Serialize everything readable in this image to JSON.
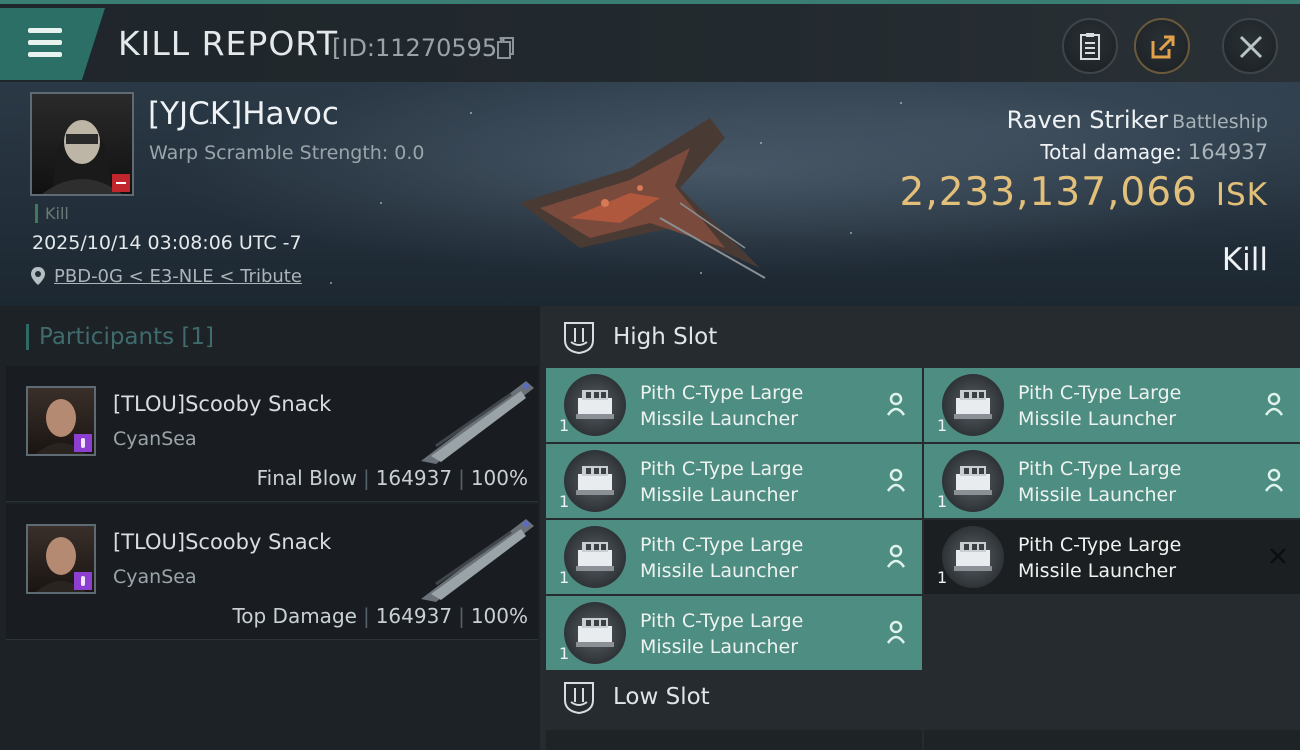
{
  "header": {
    "title": "KILL REPORT",
    "report_id": "[ID:11270595]"
  },
  "victim": {
    "name": "[YJCK]Havoc",
    "warp_scramble": "Warp Scramble Strength: 0.0",
    "tag": "Kill",
    "datetime": "2025/10/14 03:08:06 UTC -7",
    "location": "PBD-0G < E3-NLE < Tribute",
    "ship_name": "Raven Striker",
    "ship_class": "Battleship",
    "total_damage_label": "Total damage:",
    "total_damage": "164937",
    "isk_value": "2,233,137,066",
    "isk_unit": "ISK",
    "status": "Kill"
  },
  "participants": {
    "label": "Participants",
    "count": "[1]",
    "items": [
      {
        "name": "[TLOU]Scooby Snack",
        "corp": "CyanSea",
        "role": "Final Blow",
        "damage": "164937",
        "percent": "100%"
      },
      {
        "name": "[TLOU]Scooby Snack",
        "corp": "CyanSea",
        "role": "Top Damage",
        "damage": "164937",
        "percent": "100%"
      }
    ]
  },
  "slots": {
    "high_label": "High Slot",
    "low_label": "Low Slot",
    "high_modules": [
      {
        "name_line1": "Pith C-Type Large",
        "name_line2": "Missile Launcher",
        "count": "1",
        "state": "active"
      },
      {
        "name_line1": "Pith C-Type Large",
        "name_line2": "Missile Launcher",
        "count": "1",
        "state": "active"
      },
      {
        "name_line1": "Pith C-Type Large",
        "name_line2": "Missile Launcher",
        "count": "1",
        "state": "active"
      },
      {
        "name_line1": "Pith C-Type Large",
        "name_line2": "Missile Launcher",
        "count": "1",
        "state": "active"
      },
      {
        "name_line1": "Pith C-Type Large",
        "name_line2": "Missile Launcher",
        "count": "1",
        "state": "active"
      },
      {
        "name_line1": "Pith C-Type Large",
        "name_line2": "Missile Launcher",
        "count": "1",
        "state": "destroyed"
      },
      {
        "name_line1": "Pith C-Type Large",
        "name_line2": "Missile Launcher",
        "count": "1",
        "state": "active"
      }
    ]
  },
  "colors": {
    "accent_teal": "#4e8d81",
    "isk_gold": "#e2c07a",
    "minus_red": "#c0262b",
    "badge_purple": "#8c3fd1"
  },
  "icons": [
    "menu-icon",
    "copy-icon",
    "clipboard-icon",
    "share-icon",
    "close-icon",
    "location-pin-icon",
    "high-slot-icon",
    "low-slot-icon",
    "pilot-icon",
    "destroyed-x-icon"
  ]
}
